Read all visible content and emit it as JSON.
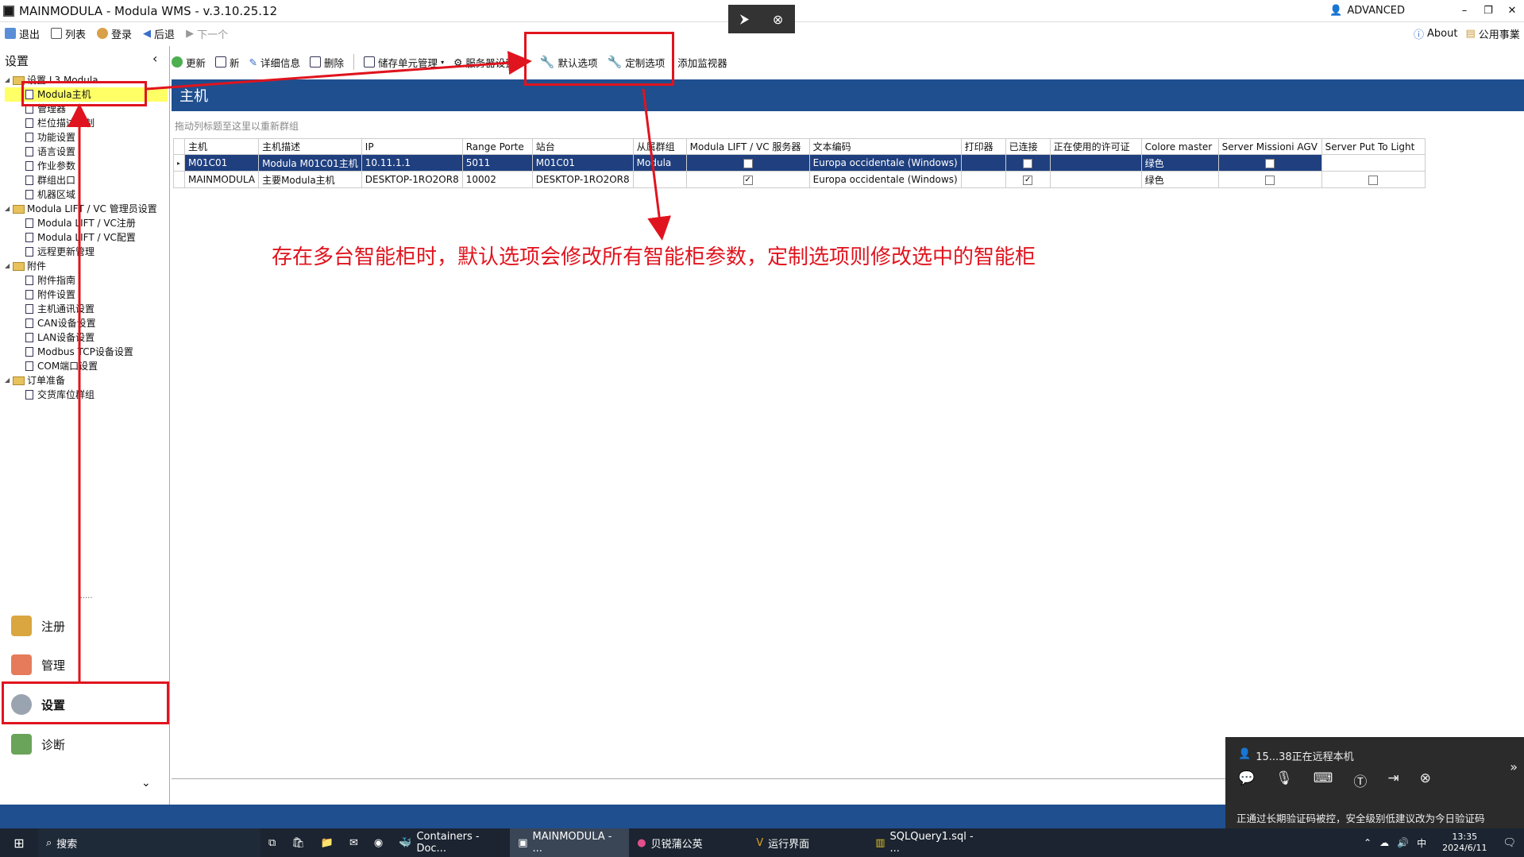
{
  "window": {
    "title": "MAINMODULA - Modula WMS - v.3.10.25.12",
    "user": "ADVANCED",
    "min": "–",
    "restore": "❐",
    "close": "✕"
  },
  "toolbar1": {
    "exit": "退出",
    "list": "列表",
    "login": "登录",
    "back": "后退",
    "next": "下一个",
    "about": "About",
    "public": "公用事業"
  },
  "toolbar2": {
    "refresh": "更新",
    "new": "新",
    "details": "详细信息",
    "delete": "删除",
    "storage": "储存单元管理",
    "service": "服务器设置",
    "default_opt": "默认选项",
    "custom_opt": "定制选项",
    "add_monitor": "添加监视器"
  },
  "left": {
    "title": "设置",
    "collapse": "‹",
    "splitter": "......",
    "more": "⌄"
  },
  "tree": [
    {
      "label": "设置 L3 Modula",
      "level": 0,
      "kind": "folder"
    },
    {
      "label": "Modula主机",
      "level": 1,
      "kind": "doc",
      "selected": true
    },
    {
      "label": "管理器",
      "level": 1,
      "kind": "doc"
    },
    {
      "label": "栏位描述定制",
      "level": 1,
      "kind": "doc"
    },
    {
      "label": "功能设置",
      "level": 1,
      "kind": "doc"
    },
    {
      "label": "语言设置",
      "level": 1,
      "kind": "doc"
    },
    {
      "label": "作业参数",
      "level": 1,
      "kind": "doc"
    },
    {
      "label": "群组出口",
      "level": 1,
      "kind": "doc"
    },
    {
      "label": "机器区域",
      "level": 1,
      "kind": "doc"
    },
    {
      "label": "Modula LIFT / VC 管理员设置",
      "level": 0,
      "kind": "folder"
    },
    {
      "label": "Modula LIFT / VC注册",
      "level": 1,
      "kind": "doc"
    },
    {
      "label": "Modula LIFT / VC配置",
      "level": 1,
      "kind": "doc"
    },
    {
      "label": "远程更新管理",
      "level": 1,
      "kind": "doc"
    },
    {
      "label": "附件",
      "level": 0,
      "kind": "folder"
    },
    {
      "label": "附件指南",
      "level": 1,
      "kind": "doc"
    },
    {
      "label": "附件设置",
      "level": 1,
      "kind": "doc"
    },
    {
      "label": "主机通讯设置",
      "level": 1,
      "kind": "doc"
    },
    {
      "label": "CAN设备设置",
      "level": 1,
      "kind": "doc"
    },
    {
      "label": "LAN设备设置",
      "level": 1,
      "kind": "doc"
    },
    {
      "label": "Modbus TCP设备设置",
      "level": 1,
      "kind": "doc"
    },
    {
      "label": "COM端口设置",
      "level": 1,
      "kind": "doc"
    },
    {
      "label": "订单准备",
      "level": 0,
      "kind": "folder"
    },
    {
      "label": "交货库位群组",
      "level": 1,
      "kind": "doc"
    }
  ],
  "nav": {
    "register": "注册",
    "manage": "管理",
    "settings": "设置",
    "diagnose": "诊断"
  },
  "main": {
    "header": "主机",
    "group_hint": "拖动列标题至这里以重新群组"
  },
  "grid": {
    "columns": [
      "主机",
      "主机描述",
      "IP",
      "Range Porte",
      "站台",
      "从属群组",
      "Modula LIFT / VC 服务器",
      "文本编码",
      "打印器",
      "已连接",
      "正在使用的许可证",
      "Colore master",
      "Server Missioni AGV",
      "Server Put To Light"
    ],
    "rows": [
      {
        "host": "M01C01",
        "desc": "Modula M01C01主机",
        "ip": "10.11.1.1",
        "range": "5011",
        "station": "M01C01",
        "group": "Modula",
        "vc": false,
        "enc": "Europa occidentale (Windows)",
        "printer": "",
        "connected": false,
        "license": "",
        "color": "绿色",
        "agv": false,
        "ptl": ""
      },
      {
        "host": "MAINMODULA",
        "desc": "主要Modula主机",
        "ip": "DESKTOP-1RO2OR8",
        "range": "10002",
        "station": "DESKTOP-1RO2OR8",
        "group": "",
        "vc": true,
        "enc": "Europa occidentale (Windows)",
        "printer": "",
        "connected": true,
        "license": "",
        "color": "绿色",
        "agv": false,
        "ptl": false
      }
    ]
  },
  "annotation": {
    "text": "存在多台智能柜时，默认选项会修改所有智能柜参数，定制选项则修改选中的智能柜"
  },
  "remote": {
    "status": "15...38正在远程本机",
    "notice": "正通过长期验证码被控，安全级别低建议改为今日验证码",
    "more": "»"
  },
  "remote_toolbar": {
    "arrow": "⮞",
    "close": "⊗"
  },
  "taskbar": {
    "search": "搜索",
    "t1": "Containers - Doc...",
    "t2": "MAINMODULA - ...",
    "t3": "贝锐蒲公英",
    "t4": "运行界面",
    "t5": "SQLQuery1.sql - ...",
    "time": "13:35",
    "date": "2024/6/11",
    "lang": "中"
  },
  "colors": {
    "accent": "#1f4f8f",
    "annotation": "#e0141e",
    "highlight": "#ffff66"
  }
}
